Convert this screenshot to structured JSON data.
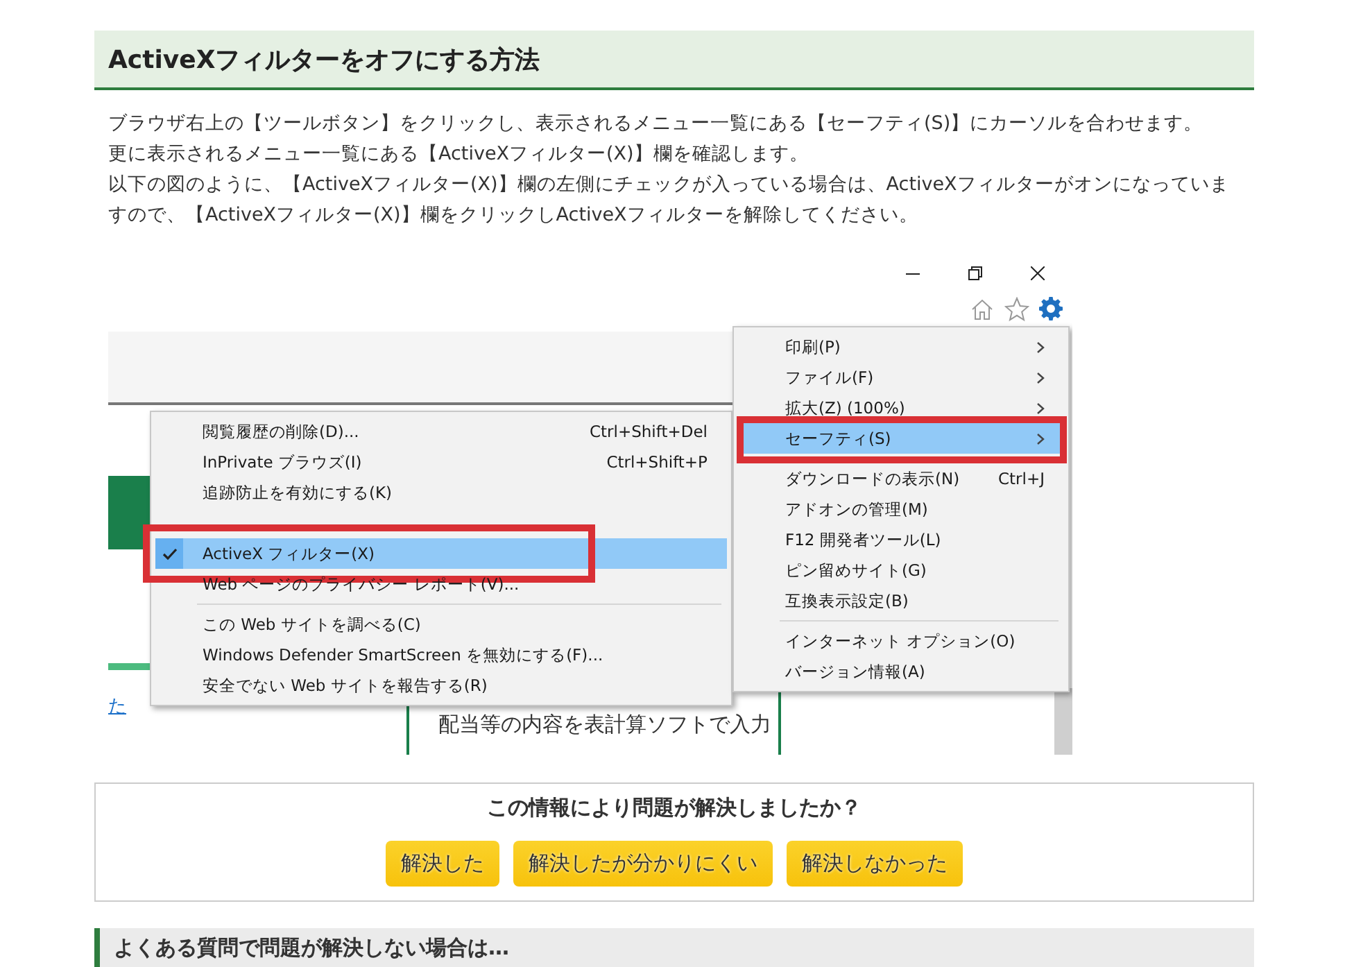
{
  "article": {
    "title": "ActiveXフィルターをオフにする方法",
    "paragraph_lines": [
      "ブラウザ右上の【ツールボタン】をクリックし、表示されるメニュー一覧にある【セーフティ(S)】にカーソルを合わせます。",
      "更に表示されるメニュー一覧にある【ActiveXフィルター(X)】欄を確認します。",
      "以下の図のように、【ActiveXフィルター(X)】欄の左側にチェックが入っている場合は、ActiveXフィルターがオンになっていますので、【ActiveXフィルター(X)】欄をクリックしActiveXフィルターを解除してください。"
    ]
  },
  "screenshot": {
    "page_link": "た",
    "page_text": "配当等の内容を表計算ソフトで入力",
    "safety_menu": [
      {
        "kind": "item",
        "label": "閲覧履歴の削除(D)...",
        "shortcut": "Ctrl+Shift+Del",
        "selected": false,
        "checked": false,
        "highlighted": false
      },
      {
        "kind": "item",
        "label": "InPrivate ブラウズ(I)",
        "shortcut": "Ctrl+Shift+P",
        "selected": false,
        "checked": false,
        "highlighted": false
      },
      {
        "kind": "item",
        "label": "追跡防止を有効にする(K)",
        "selected": false,
        "checked": false,
        "highlighted": false
      },
      {
        "kind": "blank"
      },
      {
        "kind": "item",
        "label": "ActiveX フィルター(X)",
        "selected": true,
        "checked": true,
        "highlighted": true
      },
      {
        "kind": "item",
        "label": "Web ページのプライバシー レポート(V)...",
        "selected": false,
        "checked": false,
        "highlighted": false
      },
      {
        "kind": "separator"
      },
      {
        "kind": "item",
        "label": "この Web サイトを調べる(C)",
        "selected": false,
        "checked": false,
        "highlighted": false
      },
      {
        "kind": "item",
        "label": "Windows Defender SmartScreen を無効にする(F)...",
        "selected": false,
        "checked": false,
        "highlighted": false
      },
      {
        "kind": "item",
        "label": "安全でない Web サイトを報告する(R)",
        "selected": false,
        "checked": false,
        "highlighted": false
      }
    ],
    "tools_menu": [
      {
        "kind": "item",
        "label": "印刷(P)",
        "submenu": true,
        "selected": false,
        "highlighted": false
      },
      {
        "kind": "item",
        "label": "ファイル(F)",
        "submenu": true,
        "selected": false,
        "highlighted": false
      },
      {
        "kind": "item",
        "label": "拡大(Z) (100%)",
        "submenu": true,
        "selected": false,
        "highlighted": false
      },
      {
        "kind": "item",
        "label": "セーフティ(S)",
        "submenu": true,
        "selected": true,
        "highlighted": true
      },
      {
        "kind": "item",
        "label": "ダウンロードの表示(N)",
        "shortcut": "Ctrl+J",
        "submenu": false,
        "selected": false,
        "highlighted": false
      },
      {
        "kind": "item",
        "label": "アドオンの管理(M)",
        "submenu": false,
        "selected": false,
        "highlighted": false
      },
      {
        "kind": "item",
        "label": "F12 開発者ツール(L)",
        "submenu": false,
        "selected": false,
        "highlighted": false
      },
      {
        "kind": "item",
        "label": "ピン留めサイト(G)",
        "submenu": false,
        "selected": false,
        "highlighted": false
      },
      {
        "kind": "item",
        "label": "互換表示設定(B)",
        "submenu": false,
        "selected": false,
        "highlighted": false
      },
      {
        "kind": "separator"
      },
      {
        "kind": "item",
        "label": "インターネット オプション(O)",
        "submenu": false,
        "selected": false,
        "highlighted": false
      },
      {
        "kind": "item",
        "label": "バージョン情報(A)",
        "submenu": false,
        "selected": false,
        "highlighted": false
      }
    ]
  },
  "feedback": {
    "question": "この情報により問題が解決しましたか？",
    "buttons": [
      "解決した",
      "解決したが分かりにくい",
      "解決しなかった"
    ]
  },
  "related": {
    "title": "よくある質問で問題が解決しない場合は…"
  }
}
